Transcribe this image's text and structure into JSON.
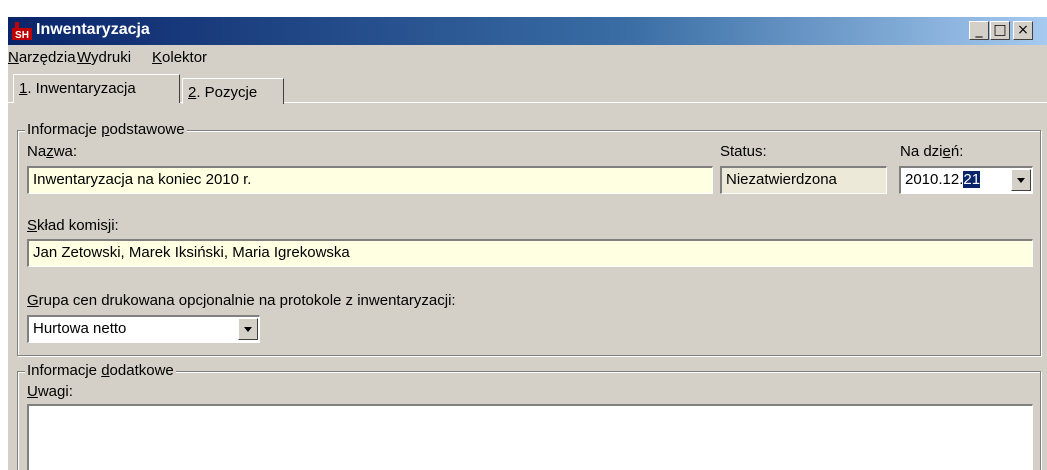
{
  "window": {
    "title": "Inwentaryzacja",
    "icon": "SH"
  },
  "titlebar_buttons": {
    "minimize": "_",
    "maximize": "□",
    "close": "×"
  },
  "menu": [
    {
      "accel": "N",
      "rest": "arzędzia"
    },
    {
      "accel": "W",
      "rest": "ydruki"
    },
    {
      "accel": "K",
      "rest": "olektor"
    }
  ],
  "tabs": [
    {
      "accel": "1",
      "rest": ". Inwentaryzacja",
      "active": true
    },
    {
      "accel": "2",
      "rest": ". Pozycje",
      "active": false
    }
  ],
  "basic_info": {
    "group_title_pre": "Informacje ",
    "group_title_accel": "p",
    "group_title_post": "odstawowe",
    "name_label_pre": "Na",
    "name_label_accel": "z",
    "name_label_post": "wa:",
    "name_value": "Inwentaryzacja na koniec 2010 r.",
    "status_label": "Status:",
    "status_value": "Niezatwierdzona",
    "date_label_pre": "Na dzi",
    "date_label_accel": "e",
    "date_label_post": "ń:",
    "date_prefix": "2010.12.",
    "date_day": "21",
    "committee_label_accel": "S",
    "committee_label_rest": "kład komisji:",
    "committee_value": "Jan Zetowski, Marek Iksiński, Maria Igrekowska",
    "price_group_label_accel": "G",
    "price_group_label_rest": "rupa cen drukowana opcjonalnie na protokole z inwentaryzacji:",
    "price_group_value": "Hurtowa netto"
  },
  "extra_info": {
    "group_title_pre": "Informacje ",
    "group_title_accel": "d",
    "group_title_post": "odatkowe",
    "notes_label_accel": "U",
    "notes_label_rest": "wagi:",
    "notes_value": ""
  }
}
